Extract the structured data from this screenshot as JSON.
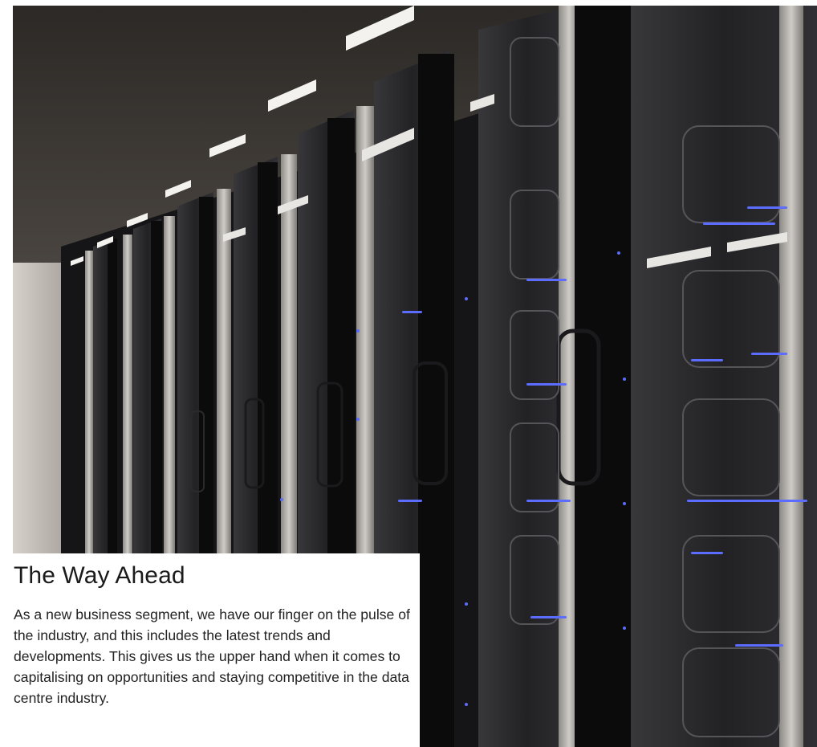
{
  "section": {
    "title": "The Way Ahead",
    "body": "As a new business segment, we have our finger on the pulse of the industry, and this includes the latest trends and developments. This gives us the upper hand when it comes to capitalising on opportunities and staying competitive in the data centre industry."
  },
  "hero_image": {
    "subject": "server-racks-photo",
    "palette": {
      "ceiling": "#3a3633",
      "wall": "#c9c4bd",
      "rack_frame": "#b9b6b2",
      "rack_dark": "#0b0b0c",
      "glass": "#2a2a2d",
      "light_strip": "#f4f2ee",
      "led": "#5b6cff"
    }
  }
}
